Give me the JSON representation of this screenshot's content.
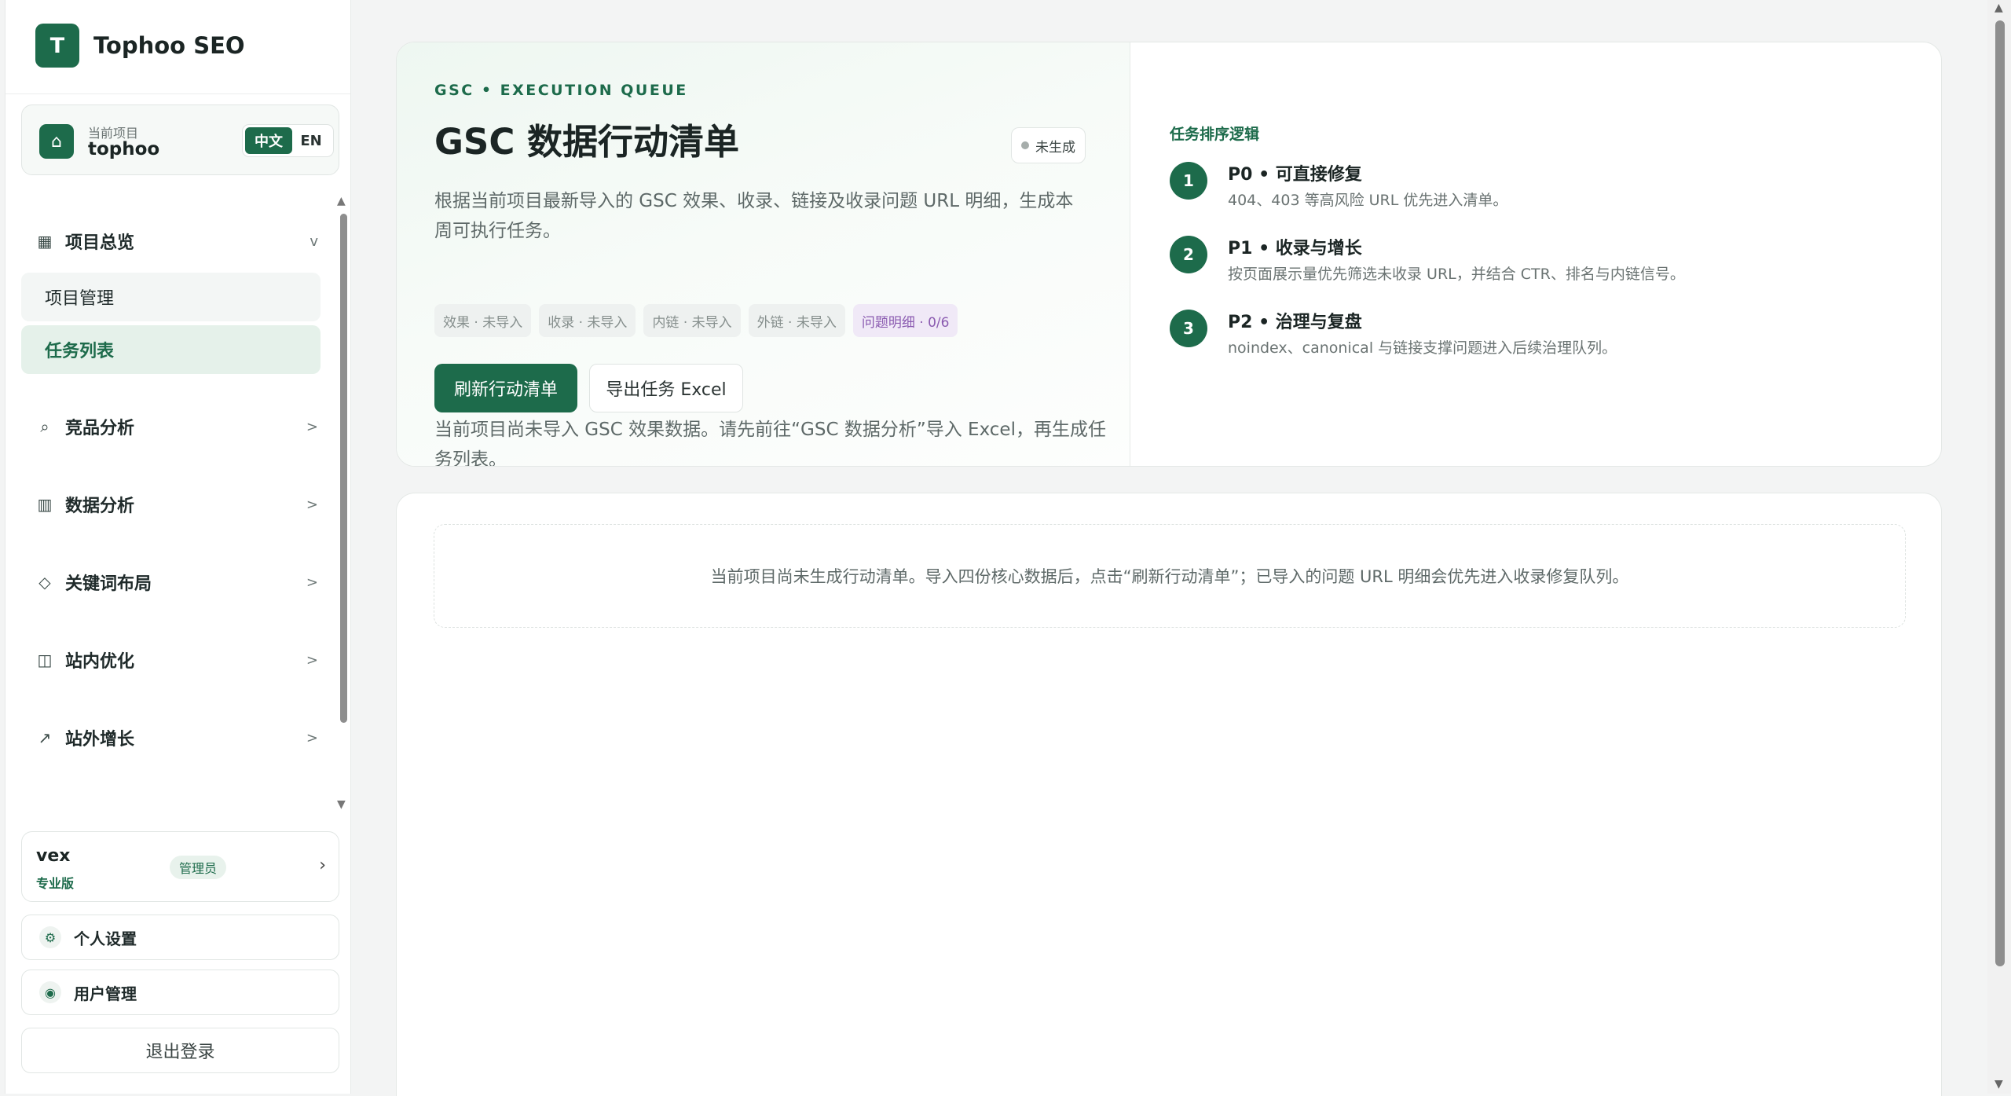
{
  "brand": {
    "logo_letter": "T",
    "name": "Tophoo SEO"
  },
  "project": {
    "caption": "当前项目",
    "name": "tophoo",
    "lang_active": "中文",
    "lang_other": "EN"
  },
  "menu": {
    "overview": {
      "label": "项目总览",
      "icon": "grid-icon",
      "chevron": "v"
    },
    "sub_items": [
      {
        "label": "项目管理",
        "active": false
      },
      {
        "label": "任务列表",
        "active": true
      }
    ],
    "groups": [
      {
        "label": "竞品分析",
        "icon": "search-icon",
        "glyph": "⌕",
        "chevron": ">"
      },
      {
        "label": "数据分析",
        "icon": "columns-icon",
        "glyph": "▥",
        "chevron": ">"
      },
      {
        "label": "关键词布局",
        "icon": "diamond-icon",
        "glyph": "◇",
        "chevron": ">"
      },
      {
        "label": "站内优化",
        "icon": "layout-icon",
        "glyph": "◫",
        "chevron": ">"
      },
      {
        "label": "站外增长",
        "icon": "trend-up-icon",
        "glyph": "↗",
        "chevron": ">"
      }
    ]
  },
  "user": {
    "name": "vex",
    "plan": "专业版",
    "role": "管理员",
    "chevron": "›"
  },
  "actions": {
    "settings": "个人设置",
    "users": "用户管理",
    "logout": "退出登录"
  },
  "hero": {
    "eyebrow": "GSC • EXECUTION QUEUE",
    "title": "GSC 数据行动清单",
    "status": "未生成",
    "description": "根据当前项目最新导入的 GSC 效果、收录、链接及收录问题 URL 明细，生成本周可执行任务。",
    "chips": [
      "效果 · 未导入",
      "收录 · 未导入",
      "内链 · 未导入",
      "外链 · 未导入",
      "问题明细 · 0/6"
    ],
    "primary_button": "刷新行动清单",
    "secondary_button": "导出任务 Excel",
    "warning": "当前项目尚未导入 GSC 效果数据。请先前往“GSC 数据分析”导入 Excel，再生成任务列表。"
  },
  "logic": {
    "title": "任务排序逻辑",
    "items": [
      {
        "num": "1",
        "head": "P0 • 可直接修复",
        "sub": "404、403 等高风险 URL 优先进入清单。"
      },
      {
        "num": "2",
        "head": "P1 • 收录与增长",
        "sub": "按页面展示量优先筛选未收录 URL，并结合 CTR、排名与内链信号。"
      },
      {
        "num": "3",
        "head": "P2 • 治理与复盘",
        "sub": "noindex、canonical 与链接支撑问题进入后续治理队列。"
      }
    ]
  },
  "empty_state": "当前项目尚未生成行动清单。导入四份核心数据后，点击“刷新行动清单”；已导入的问题 URL 明细会优先进入收录修复队列。",
  "colors": {
    "accent": "#1d6b4b",
    "chip_purple": "#8a5ab0"
  }
}
